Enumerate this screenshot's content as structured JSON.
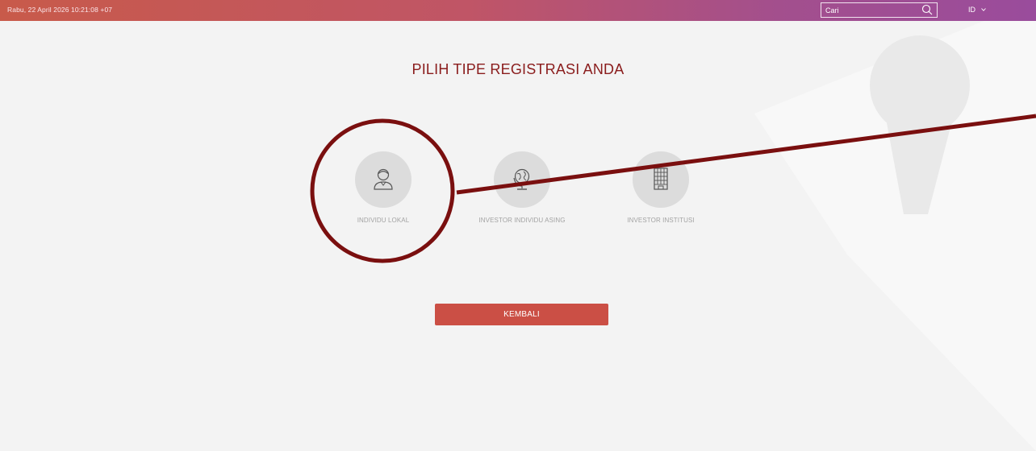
{
  "header": {
    "datetime": "Rabu, 22 April 2026 10:21:08 +07",
    "search": {
      "placeholder": "Cari"
    },
    "language": "ID"
  },
  "page": {
    "title": "PILIH TIPE REGISTRASI ANDA"
  },
  "options": [
    {
      "label": "INDIVIDU LOKAL",
      "icon": "person-icon"
    },
    {
      "label": "INVESTOR INDIVIDU ASING",
      "icon": "globe-icon"
    },
    {
      "label": "INVESTOR INSTITUSI",
      "icon": "building-icon"
    }
  ],
  "actions": {
    "back_label": "KEMBALI"
  },
  "colors": {
    "accent": "#8a1c1c",
    "button": "#cb4f45",
    "header_start": "#c85a4a",
    "header_end": "#9a4c9c",
    "annotation": "#7a0f0f"
  }
}
